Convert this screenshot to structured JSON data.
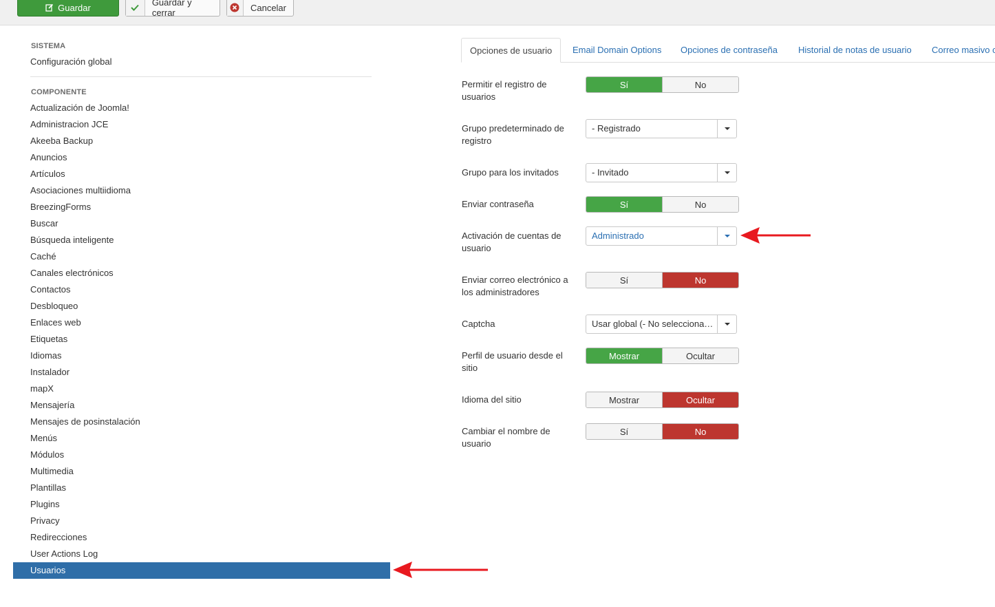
{
  "toolbar": {
    "save_label": "Guardar",
    "save_close_label": "Guardar y cerrar",
    "cancel_label": "Cancelar"
  },
  "sidebar": {
    "system_title": "SISTEMA",
    "global_config": "Configuración global",
    "component_title": "COMPONENTE",
    "items": [
      "Actualización de Joomla!",
      "Administracion JCE",
      "Akeeba Backup",
      "Anuncios",
      "Artículos",
      "Asociaciones multiidioma",
      "BreezingForms",
      "Buscar",
      "Búsqueda inteligente",
      "Caché",
      "Canales electrónicos",
      "Contactos",
      "Desbloqueo",
      "Enlaces web",
      "Etiquetas",
      "Idiomas",
      "Instalador",
      "mapX",
      "Mensajería",
      "Mensajes de posinstalación",
      "Menús",
      "Módulos",
      "Multimedia",
      "Plantillas",
      "Plugins",
      "Privacy",
      "Redirecciones",
      "User Actions Log",
      "Usuarios"
    ],
    "active_item": "Usuarios"
  },
  "tabs": [
    "Opciones de usuario",
    "Email Domain Options",
    "Opciones de contraseña",
    "Historial de notas de usuario",
    "Correo masivo c"
  ],
  "form": {
    "allow_registration": {
      "label": "Permitir el registro de usuarios",
      "yes": "Sí",
      "no": "No",
      "selected": "yes"
    },
    "default_group": {
      "label": "Grupo predeterminado de registro",
      "value": "- Registrado"
    },
    "guest_group": {
      "label": "Grupo para los invitados",
      "value": "- Invitado"
    },
    "send_password": {
      "label": "Enviar contraseña",
      "yes": "Sí",
      "no": "No",
      "selected": "yes"
    },
    "account_activation": {
      "label": "Activación de cuentas de usuario",
      "value": "Administrado"
    },
    "notify_admins": {
      "label": "Enviar correo electrónico a los administradores",
      "yes": "Sí",
      "no": "No",
      "selected": "no"
    },
    "captcha": {
      "label": "Captcha",
      "value": "Usar global (- No seleccionado -)"
    },
    "frontend_profile": {
      "label": "Perfil de usuario desde el sitio",
      "show": "Mostrar",
      "hide": "Ocultar",
      "selected": "show"
    },
    "site_language": {
      "label": "Idioma del sitio",
      "show": "Mostrar",
      "hide": "Ocultar",
      "selected": "hide"
    },
    "change_username": {
      "label": "Cambiar el nombre de usuario",
      "yes": "Sí",
      "no": "No",
      "selected": "no"
    }
  },
  "colors": {
    "success_green": "#46a546",
    "danger_red": "#bd362f",
    "active_blue": "#2f6ea8",
    "link_blue": "#2a6fb2",
    "annotation_arrow": "#e8191f"
  }
}
